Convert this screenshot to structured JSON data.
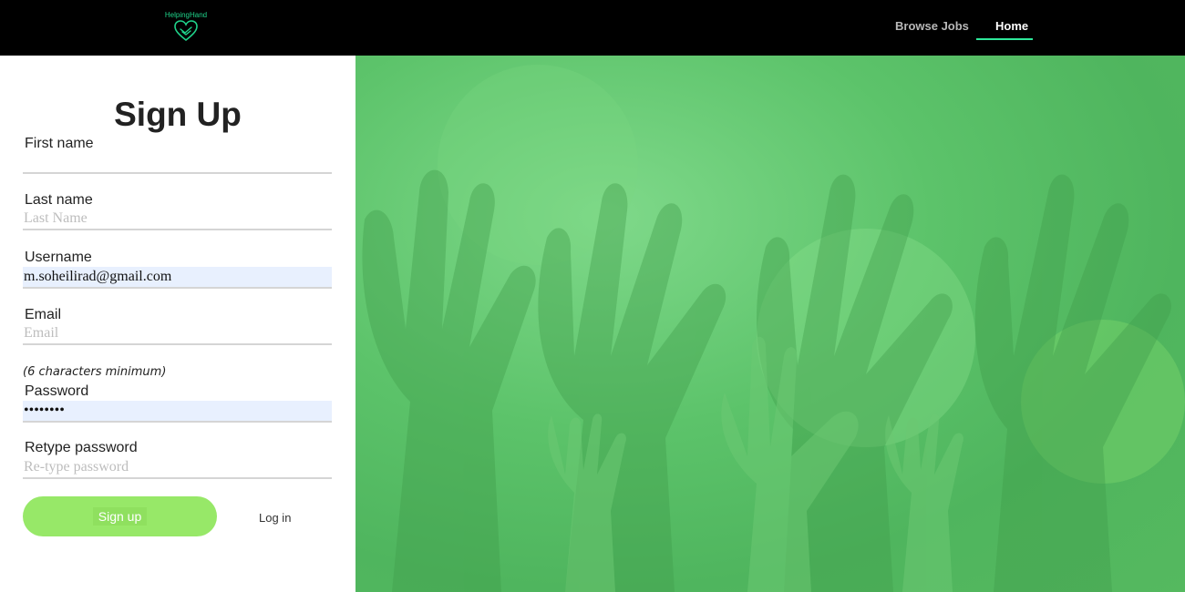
{
  "brand": {
    "name": "HelpingHand",
    "accent": "#1fd38a"
  },
  "nav": {
    "items": [
      {
        "label": "Browse Jobs",
        "active": false
      },
      {
        "label": "Home",
        "active": true
      }
    ],
    "active_indicator_color": "#2ee89a"
  },
  "form": {
    "title": "Sign Up",
    "fields": {
      "first_name": {
        "label": "First name",
        "value": "",
        "placeholder": ""
      },
      "last_name": {
        "label": "Last name",
        "value": "",
        "placeholder": "Last Name"
      },
      "username": {
        "label": "Username",
        "value": "m.soheilirad@gmail.com",
        "placeholder": ""
      },
      "email": {
        "label": "Email",
        "value": "",
        "placeholder": "Email"
      },
      "password": {
        "label": "Password",
        "hint": "(6 characters minimum)",
        "value": "••••••••",
        "placeholder": ""
      },
      "retype_password": {
        "label": "Retype password",
        "value": "",
        "placeholder": "Re-type password"
      }
    },
    "signup_button": "Sign up",
    "login_link": "Log in",
    "button_color": "#97e868"
  },
  "hero": {
    "icon": "raised-hands-image",
    "tint": "#5cc36a"
  }
}
